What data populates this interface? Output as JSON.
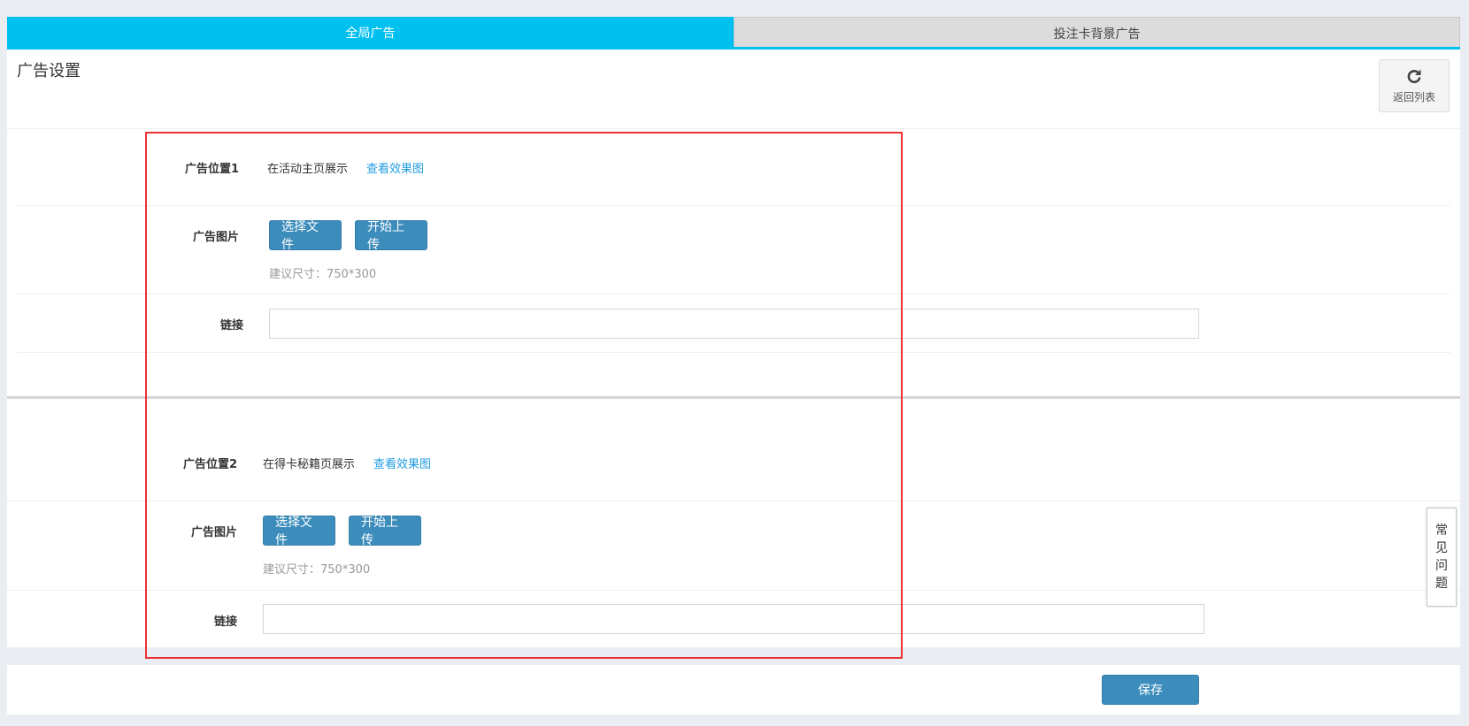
{
  "tabs": [
    {
      "label": "全局广告",
      "active": true
    },
    {
      "label": "投注卡背景广告",
      "active": false
    }
  ],
  "section_title": "广告设置",
  "back_button": {
    "label": "返回列表",
    "icon": "refresh-icon"
  },
  "ad1": {
    "position_label": "广告位置1",
    "position_text": "在活动主页展示",
    "preview_link": "查看效果图",
    "image_label": "广告图片",
    "choose_file": "选择文件",
    "start_upload": "开始上传",
    "size_hint": "建议尺寸：750*300",
    "link_label": "链接",
    "link_value": ""
  },
  "ad2": {
    "position_label": "广告位置2",
    "position_text": "在得卡秘籍页展示",
    "preview_link": "查看效果图",
    "image_label": "广告图片",
    "choose_file": "选择文件",
    "start_upload": "开始上传",
    "size_hint": "建议尺寸：750*300",
    "link_label": "链接",
    "link_value": ""
  },
  "faq": {
    "chars": [
      "常",
      "见",
      "问",
      "题"
    ]
  },
  "save_button": "保存",
  "colors": {
    "accent": "#00c0ef",
    "button": "#3c8dbc",
    "link": "#1e9be0",
    "highlight_box": "#ee3135",
    "background": "#eaedf2"
  }
}
